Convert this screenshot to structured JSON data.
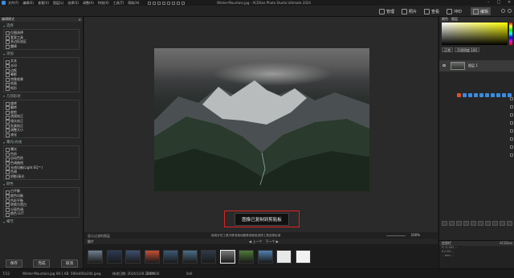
{
  "titlebar": {
    "menus": [
      "文件(F)",
      "编辑(E)",
      "查看(V)",
      "图层(L)",
      "选择(S)",
      "调整(A)",
      "特效(X)",
      "工具(T)",
      "帮助(H)"
    ],
    "title": "Winter-Mountain.jpg - ACDSee Photo Studio Ultimate 2024",
    "minimize": "–",
    "maximize": "□",
    "close": "✕"
  },
  "modes": {
    "manage": "管理",
    "photos": "照片",
    "view": "查看",
    "develop": "冲印",
    "edit": "编辑"
  },
  "left_panel": {
    "header": "编辑模式",
    "sections": [
      {
        "title": "选择",
        "items": [
          "位图选择",
          "套索工具",
          "多边形选区",
          "魔棒"
        ]
      },
      {
        "title": "添加",
        "items": [
          "文本",
          "水印",
          "边框",
          "晕影",
          "特殊效果",
          "绘画",
          "矩形"
        ]
      },
      {
        "title": "几何形状",
        "items": [
          "旋转",
          "翻转",
          "裁剪",
          "透视校正",
          "镜头校正",
          "失真校正",
          "调整大小",
          "液化"
        ]
      },
      {
        "title": "曝光/光线",
        "items": [
          "曝光",
          "色阶",
          "自动色阶",
          "色调曲线",
          "光线均衡(Light EQ™)",
          "色调",
          "阴影/高光"
        ]
      },
      {
        "title": "颜色",
        "items": [
          "白平衡",
          "颜色均衡",
          "色彩平衡",
          "转换为黑白",
          "分离色调",
          "颜色 LUT"
        ]
      },
      {
        "title": "细节",
        "items": []
      }
    ],
    "footer": {
      "save": "保存",
      "done": "完成",
      "cancel": "取消"
    }
  },
  "canvas": {
    "toast": "图像已复制到剪贴板"
  },
  "center_strip": {
    "left_label": "显示过滤的图层",
    "hint": "使用手形工具平移或拖动图像或使用选择工具选择区域",
    "zoom": "100%"
  },
  "filmstrip": {
    "label": "胶片",
    "prev": "上一个",
    "next": "下一个",
    "thumb_colors": [
      "#6e7f91",
      "#2b3a55",
      "#3c4f6e",
      "#c44f36",
      "#3b5a75",
      "#4b6e86",
      "#303a4a",
      "#7a7a7a",
      "#4f7a3a",
      "#4e7fb0",
      "#e8e8e8",
      "#f2f2f2"
    ],
    "selected_index": 7
  },
  "right_panel": {
    "tabs": [
      "颜色",
      "图层"
    ],
    "blend_mode": "正常",
    "opacity": "不透明度 100",
    "layer_name": "图层 1",
    "info_header": "信息栏",
    "info_right": "ACDSee",
    "info_lines": [
      "F/ 1/  ISO  --",
      "0.0  EV  --",
      "--  mm  --"
    ],
    "tool_colors": [
      "#e05020",
      "#3a8be0",
      "#3a8be0",
      "#3a8be0",
      "#3a8be0",
      "#3a8be0",
      "#3a8be0",
      "#3a8be0",
      "#3a8be0",
      "#3a8be0"
    ]
  },
  "status": {
    "index": "7/12",
    "file": "Winter-Mountain.jpg",
    "size": "89.1 KB",
    "dims": "590x400x24b jpeg",
    "modified": "修改日期: 2024/1/28 22:04:56",
    "zoom": "100%",
    "extra": "0x0"
  },
  "colors": {
    "accent_blue": "#3a8be0",
    "toast_border": "#d22222",
    "panel_bg": "#262626"
  }
}
